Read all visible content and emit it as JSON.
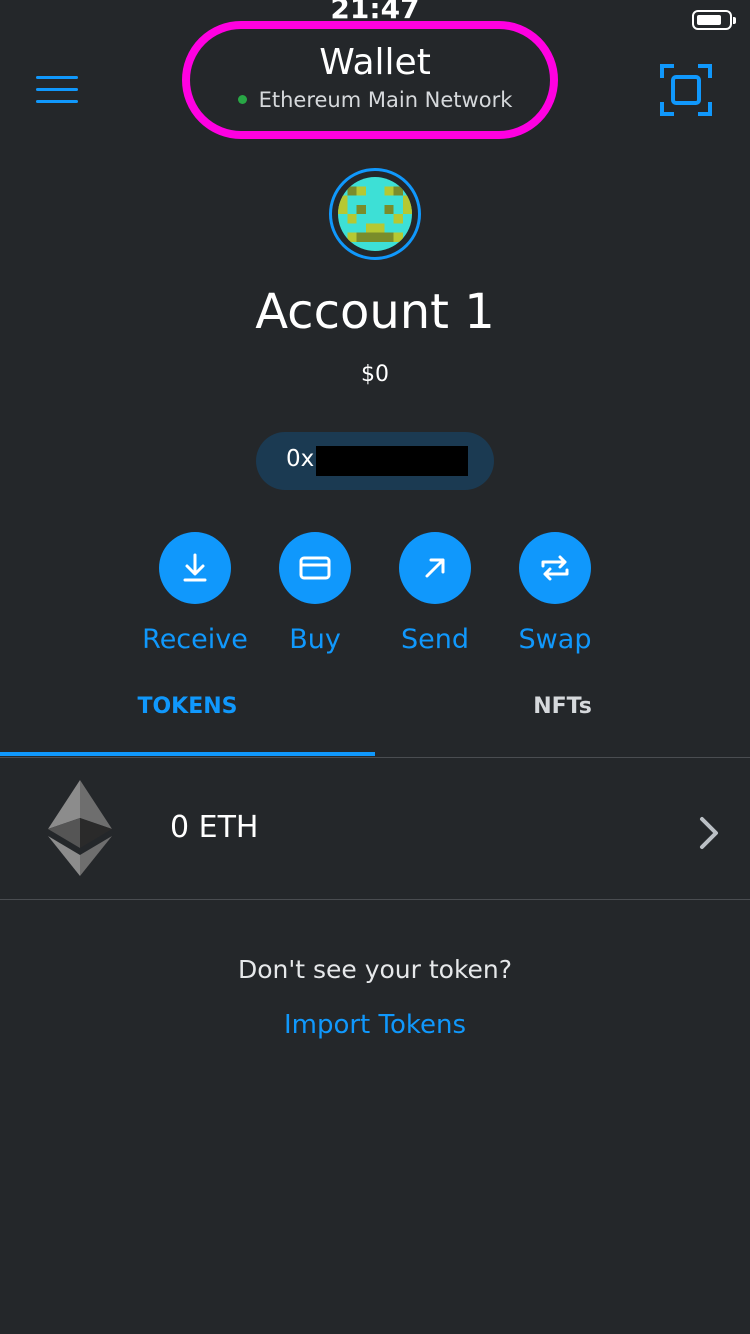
{
  "status_bar": {
    "time": "21:47"
  },
  "header": {
    "title": "Wallet",
    "network": "Ethereum Main Network",
    "menu_icon": "hamburger-menu-icon",
    "scan_icon": "qr-scan-icon"
  },
  "account": {
    "name": "Account 1",
    "balance": "$0",
    "address_prefix": "0x"
  },
  "actions": [
    {
      "label": "Receive",
      "icon": "download-icon"
    },
    {
      "label": "Buy",
      "icon": "card-icon"
    },
    {
      "label": "Send",
      "icon": "arrow-up-right-icon"
    },
    {
      "label": "Swap",
      "icon": "swap-arrows-icon"
    }
  ],
  "tabs": [
    {
      "label": "TOKENS",
      "active": true
    },
    {
      "label": "NFTs",
      "active": false
    }
  ],
  "tokens": [
    {
      "amount": "0 ETH",
      "icon": "ethereum-icon"
    }
  ],
  "empty_hint": {
    "text": "Don't see your token?",
    "link": "Import Tokens"
  },
  "colors": {
    "background": "#24272a",
    "accent": "#1098fc",
    "highlight": "#ff00e1",
    "network_dot": "#28a745"
  }
}
